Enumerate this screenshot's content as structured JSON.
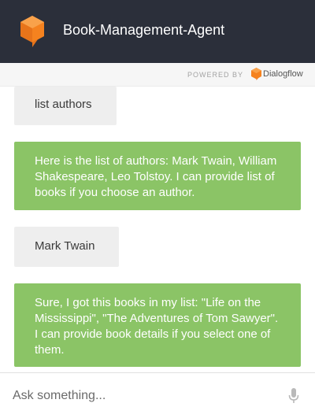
{
  "header": {
    "title": "Book-Management-Agent",
    "logo_icon": "chat-bubble-cube-icon",
    "background": "#2b2f3a"
  },
  "branding": {
    "powered_by": "POWERED BY",
    "product": "Dialogflow",
    "product_icon": "dialogflow-logo-icon"
  },
  "messages": [
    {
      "sender": "user",
      "text": "list authors"
    },
    {
      "sender": "agent",
      "text": "Here is the list of authors: Mark Twain, William Shakespeare, Leo Tolstoy. I can provide list of books if you choose an author."
    },
    {
      "sender": "user",
      "text": "Mark Twain"
    },
    {
      "sender": "agent",
      "text": "Sure, I got this books in my list: \"Life on the Mississippi\", \"The Adventures of Tom Sawyer\". I can provide book details if you select one of them."
    }
  ],
  "input": {
    "placeholder": "Ask something...",
    "value": "",
    "mic_icon": "microphone-icon"
  },
  "colors": {
    "user_bubble": "#eeeeee",
    "agent_bubble": "#8bc466",
    "accent": "#f5821f"
  }
}
